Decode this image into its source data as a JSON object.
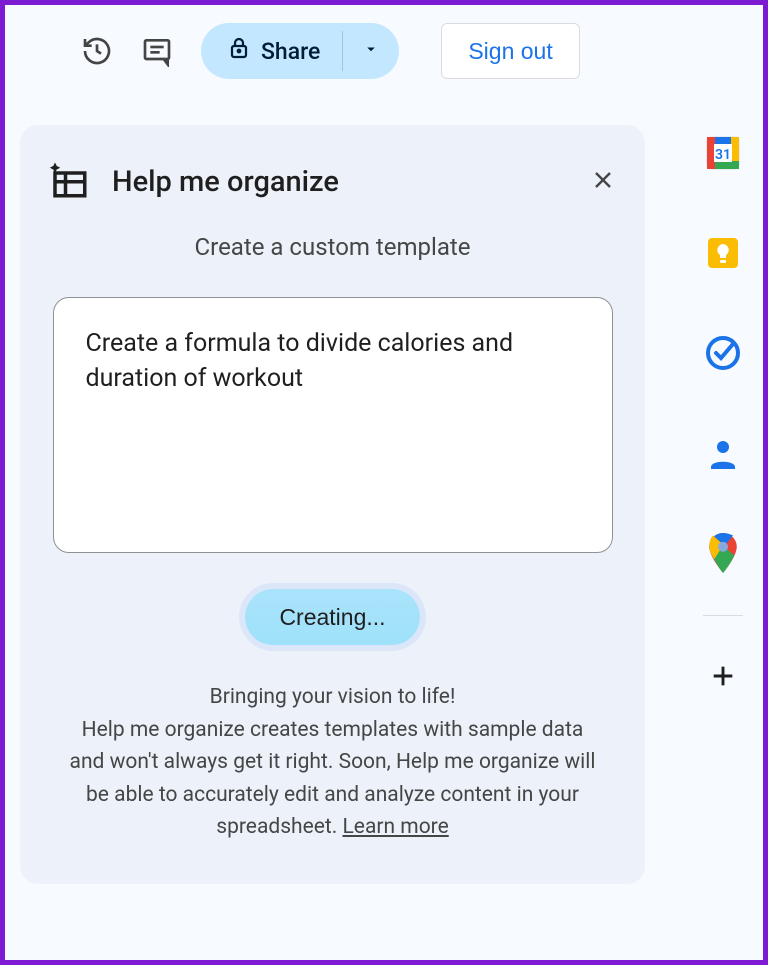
{
  "toolbar": {
    "share_label": "Share",
    "signout_label": "Sign out"
  },
  "panel": {
    "title": "Help me organize",
    "subtitle": "Create a custom template",
    "prompt_value": "Create a formula to divide calories and duration of workout",
    "creating_label": "Creating...",
    "info_lead": "Bringing your vision to life!",
    "info_body": "Help me organize creates templates with sample data and won't always get it right. Soon, Help me organize will be able to accurately edit and analyze content in your spreadsheet. ",
    "learn_more": "Learn more"
  },
  "side_apps": {
    "calendar": "calendar-icon",
    "keep": "keep-icon",
    "tasks": "tasks-icon",
    "contacts": "contacts-icon",
    "maps": "maps-icon",
    "add": "add-icon"
  }
}
